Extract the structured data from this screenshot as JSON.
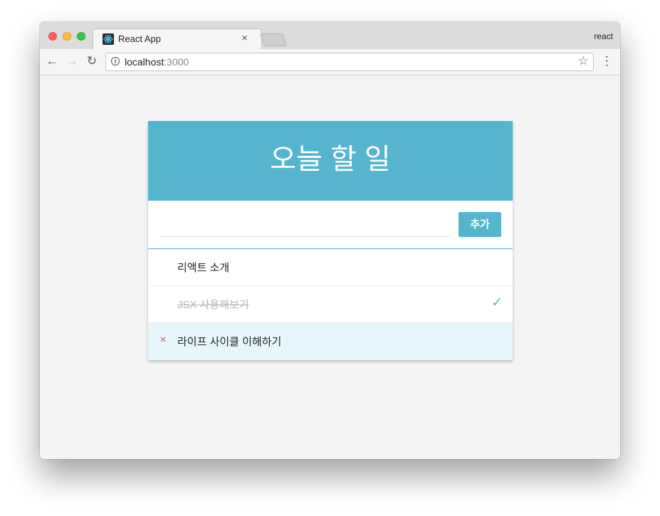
{
  "browser": {
    "tab_title": "React App",
    "tab_close": "×",
    "profile_name": "react",
    "url_host": "localhost",
    "url_port": ":3000",
    "nav_back": "←",
    "nav_forward": "→",
    "nav_reload": "↻",
    "star": "☆",
    "menu": "⋮",
    "info": "i"
  },
  "app": {
    "title": "오늘 할 일",
    "input_value": "",
    "add_label": "추가",
    "todos": [
      {
        "text": "리액트 소개",
        "checked": false
      },
      {
        "text": "JSX 사용해보기",
        "checked": true
      },
      {
        "text": "라이프 사이클 이해하기",
        "checked": false
      }
    ],
    "remove_glyph": "×",
    "check_glyph": "✓"
  },
  "colors": {
    "accent": "#55b4ce",
    "remove": "#e64980",
    "hover_bg": "#e6f7fb",
    "checked_text": "#adb5bd"
  }
}
